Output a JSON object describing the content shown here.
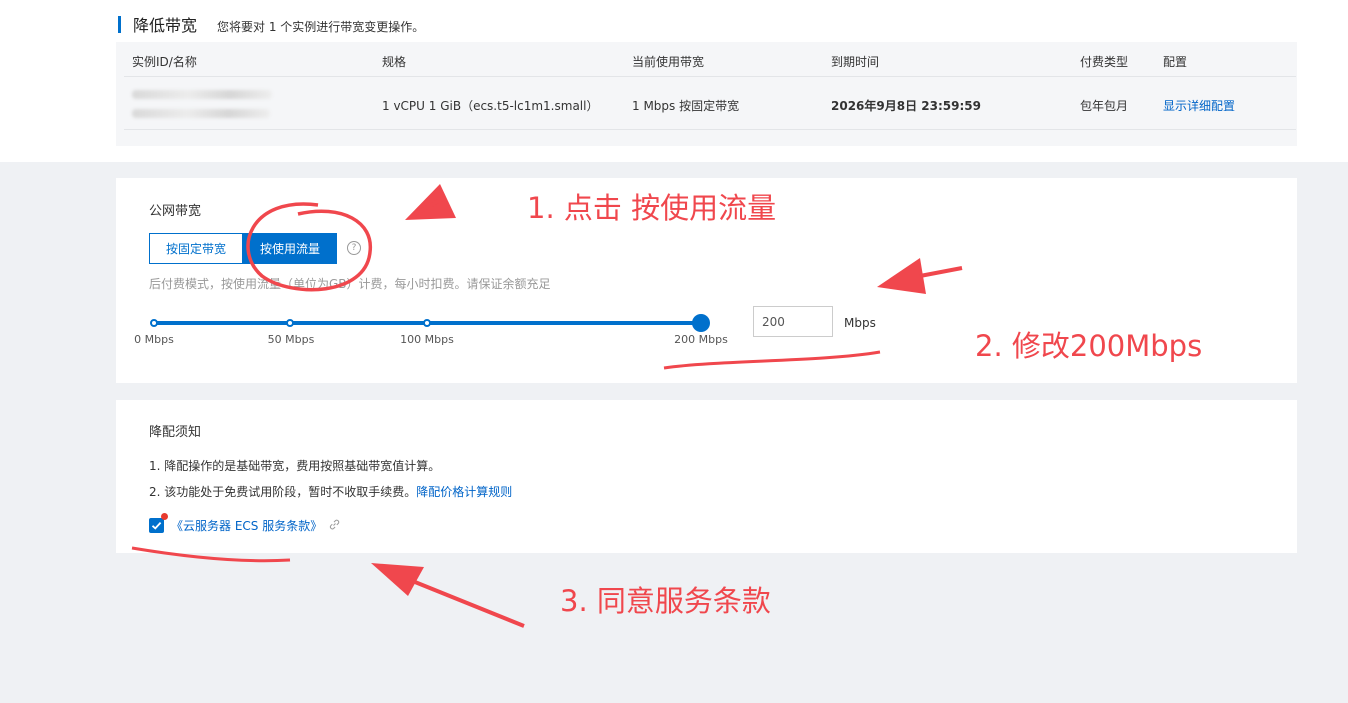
{
  "section": {
    "title": "降低带宽",
    "subtitle": "您将要对 1 个实例进行带宽变更操作。"
  },
  "table": {
    "headers": [
      "实例ID/名称",
      "规格",
      "当前使用带宽",
      "到期时间",
      "付费类型",
      "配置"
    ],
    "row": {
      "spec": "1 vCPU 1 GiB（ecs.t5-lc1m1.small）",
      "bandwidth": "1 Mbps 按固定带宽",
      "expire": "2026年9月8日 23:59:59",
      "pay_type": "包年包月",
      "config_link": "显示详细配置"
    }
  },
  "bandwidth": {
    "label": "公网带宽",
    "options": [
      "按固定带宽",
      "按使用流量"
    ],
    "selected": "按使用流量",
    "hint": "后付费模式，按使用流量（单位为GB）计费，每小时扣费。请保证余额充足",
    "slider": {
      "marks": [
        "0 Mbps",
        "50 Mbps",
        "100 Mbps",
        "200 Mbps"
      ],
      "value": 200
    },
    "input_value": "200",
    "unit": "Mbps"
  },
  "notice": {
    "title": "降配须知",
    "item1": "1. 降配操作的是基础带宽，费用按照基础带宽值计算。",
    "item2": "2. 该功能处于免费试用阶段，暂时不收取手续费。",
    "item2_link": "降配价格计算规则",
    "terms_link": "《云服务器 ECS 服务条款》",
    "terms_checked": true
  },
  "annotations": {
    "step1": "1. 点击 按使用流量",
    "step2": "2. 修改200Mbps",
    "step3": "3. 同意服务条款"
  },
  "colors": {
    "primary": "#0070cc",
    "annotation": "#f0474d",
    "link": "#0064c8"
  }
}
